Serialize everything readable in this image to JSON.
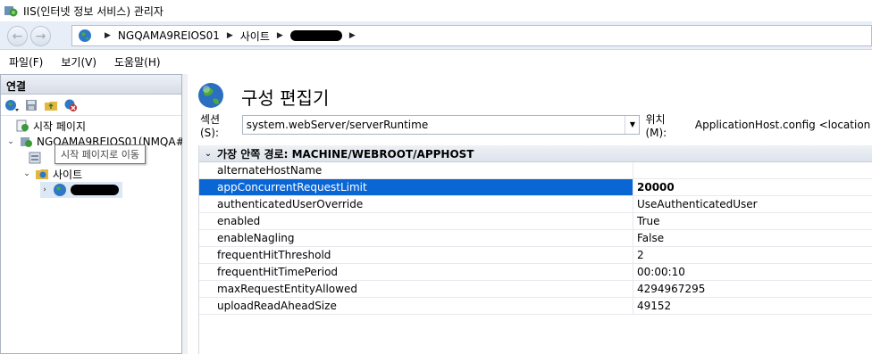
{
  "window": {
    "title": "IIS(인터넷 정보 서비스) 관리자"
  },
  "address": {
    "crumbs": [
      "NGQAMA9REIOS01",
      "사이트"
    ]
  },
  "menu": {
    "items": [
      "파일(F)",
      "보기(V)",
      "도움말(H)"
    ]
  },
  "connections": {
    "header": "연결",
    "tree": {
      "start_page": "시작 페이지",
      "server": "NGQAMA9REIOS01(NMQA#",
      "sites": "사이트"
    },
    "tooltip": "시작 페이지로 이동"
  },
  "main": {
    "title": "구성 편집기",
    "section_label": "섹션(S):",
    "section_value": "system.webServer/serverRuntime",
    "location_label": "위치(M):",
    "location_value": "ApplicationHost.config <location pat",
    "group_header": "가장 안쪽 경로: MACHINE/WEBROOT/APPHOST",
    "properties": [
      {
        "name": "alternateHostName",
        "value": ""
      },
      {
        "name": "appConcurrentRequestLimit",
        "value": "20000"
      },
      {
        "name": "authenticatedUserOverride",
        "value": "UseAuthenticatedUser"
      },
      {
        "name": "enabled",
        "value": "True"
      },
      {
        "name": "enableNagling",
        "value": "False"
      },
      {
        "name": "frequentHitThreshold",
        "value": "2"
      },
      {
        "name": "frequentHitTimePeriod",
        "value": "00:00:10"
      },
      {
        "name": "maxRequestEntityAllowed",
        "value": "4294967295"
      },
      {
        "name": "uploadReadAheadSize",
        "value": "49152"
      }
    ]
  },
  "colors": {
    "selection": "#0a66d4",
    "accent": "#e8eef7"
  }
}
